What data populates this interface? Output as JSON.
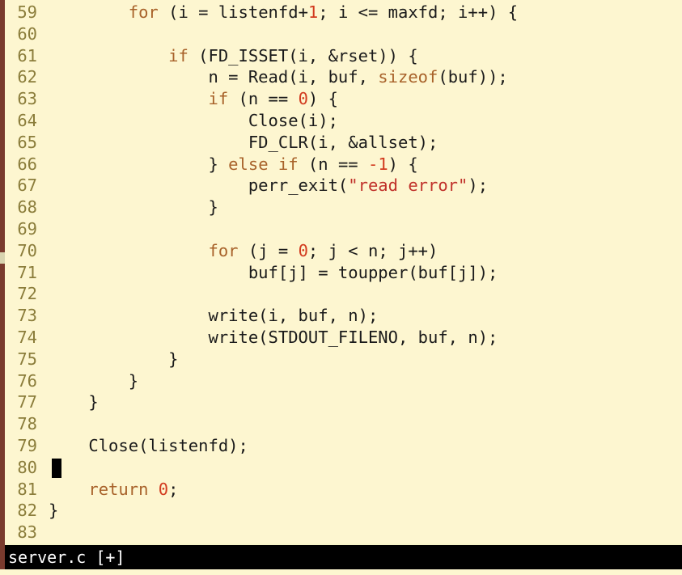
{
  "editor": {
    "cursor_line": "80",
    "lines": [
      {
        "num": "59",
        "tokens": [
          {
            "t": "        "
          },
          {
            "t": "for",
            "c": "kw"
          },
          {
            "t": " (i = listenfd+"
          },
          {
            "t": "1",
            "c": "num"
          },
          {
            "t": "; i <= maxfd; i++) {"
          }
        ]
      },
      {
        "num": "60",
        "tokens": []
      },
      {
        "num": "61",
        "tokens": [
          {
            "t": "            "
          },
          {
            "t": "if",
            "c": "kw"
          },
          {
            "t": " (FD_ISSET(i, &rset)) {"
          }
        ]
      },
      {
        "num": "62",
        "tokens": [
          {
            "t": "                n = Read(i, buf, "
          },
          {
            "t": "sizeof",
            "c": "kw"
          },
          {
            "t": "(buf));"
          }
        ]
      },
      {
        "num": "63",
        "tokens": [
          {
            "t": "                "
          },
          {
            "t": "if",
            "c": "kw"
          },
          {
            "t": " (n == "
          },
          {
            "t": "0",
            "c": "num"
          },
          {
            "t": ") {"
          }
        ]
      },
      {
        "num": "64",
        "tokens": [
          {
            "t": "                    Close(i);"
          }
        ]
      },
      {
        "num": "65",
        "tokens": [
          {
            "t": "                    FD_CLR(i, &allset);"
          }
        ]
      },
      {
        "num": "66",
        "tokens": [
          {
            "t": "                } "
          },
          {
            "t": "else",
            "c": "kw"
          },
          {
            "t": " "
          },
          {
            "t": "if",
            "c": "kw"
          },
          {
            "t": " (n == "
          },
          {
            "t": "-1",
            "c": "num"
          },
          {
            "t": ") {"
          }
        ]
      },
      {
        "num": "67",
        "tokens": [
          {
            "t": "                    perr_exit("
          },
          {
            "t": "\"read error\"",
            "c": "str"
          },
          {
            "t": ");"
          }
        ]
      },
      {
        "num": "68",
        "tokens": [
          {
            "t": "                }"
          }
        ]
      },
      {
        "num": "69",
        "tokens": []
      },
      {
        "num": "70",
        "tokens": [
          {
            "t": "                "
          },
          {
            "t": "for",
            "c": "kw"
          },
          {
            "t": " (j = "
          },
          {
            "t": "0",
            "c": "num"
          },
          {
            "t": "; j < n; j++)"
          }
        ]
      },
      {
        "num": "71",
        "tokens": [
          {
            "t": "                    buf[j] = toupper(buf[j]);"
          }
        ]
      },
      {
        "num": "72",
        "tokens": []
      },
      {
        "num": "73",
        "tokens": [
          {
            "t": "                write(i, buf, n);"
          }
        ]
      },
      {
        "num": "74",
        "tokens": [
          {
            "t": "                write(STDOUT_FILENO, buf, n);"
          }
        ]
      },
      {
        "num": "75",
        "tokens": [
          {
            "t": "            }"
          }
        ]
      },
      {
        "num": "76",
        "tokens": [
          {
            "t": "        }"
          }
        ]
      },
      {
        "num": "77",
        "tokens": [
          {
            "t": "    }"
          }
        ]
      },
      {
        "num": "78",
        "tokens": []
      },
      {
        "num": "79",
        "tokens": [
          {
            "t": "    Close(listenfd);"
          }
        ]
      },
      {
        "num": "80",
        "tokens": []
      },
      {
        "num": "81",
        "tokens": [
          {
            "t": "    "
          },
          {
            "t": "return",
            "c": "kw"
          },
          {
            "t": " "
          },
          {
            "t": "0",
            "c": "num"
          },
          {
            "t": ";"
          }
        ]
      },
      {
        "num": "82",
        "tokens": [
          {
            "t": "}"
          }
        ]
      },
      {
        "num": "83",
        "tokens": []
      }
    ]
  },
  "statusbar": {
    "filename": "server.c",
    "modified_flag": "[+]"
  },
  "colors": {
    "background": "#fdf6d0",
    "line_number": "#8b7d3b",
    "keyword": "#a8622a",
    "number": "#d23b1f",
    "string": "#c0312a",
    "statusbar_bg": "#000000",
    "statusbar_fg": "#ffffff",
    "window_border": "#7a3b2e"
  }
}
